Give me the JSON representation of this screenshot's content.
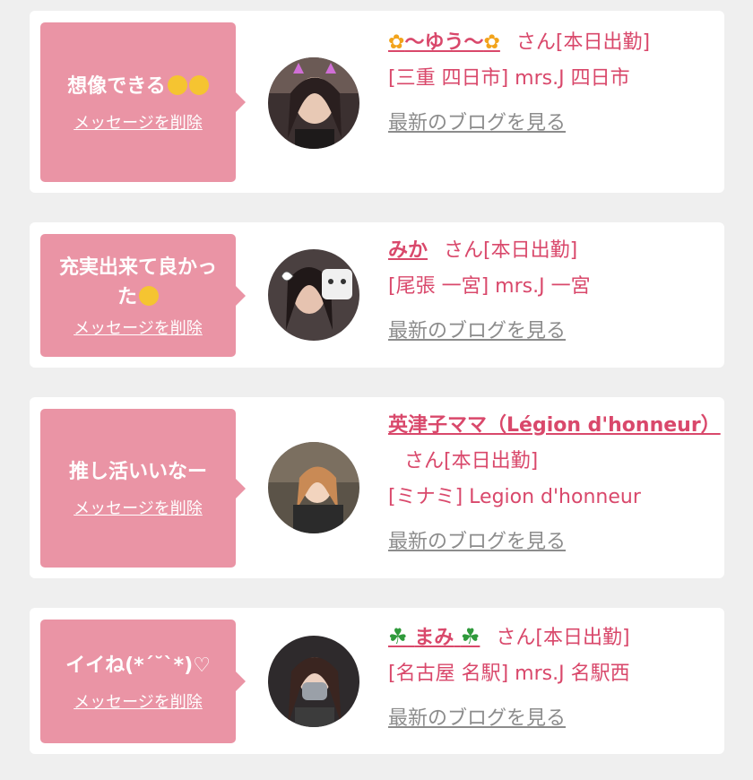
{
  "cards": [
    {
      "message": "想像できる",
      "emoji": [
        "rofl-emoji",
        "rofl-emoji"
      ],
      "delete_label": "メッセージを削除",
      "name_prefix": "✿",
      "name": "〜ゆう〜",
      "name_suffix": "✿",
      "san_status": "さん[本日出勤]",
      "shop": "[三重 四日市] mrs.J 四日市",
      "blog_label": "最新のブログを見る"
    },
    {
      "message": "充実出来て良かった",
      "emoji": [
        "hand-over-mouth-emoji"
      ],
      "delete_label": "メッセージを削除",
      "name": "みか",
      "san_status": "さん[本日出勤]",
      "shop": "[尾張 一宮] mrs.J 一宮",
      "blog_label": "最新のブログを見る"
    },
    {
      "message": "推し活いいなー",
      "delete_label": "メッセージを削除",
      "name": "英津子ママ（Légion d'honneur）",
      "san_status": "さん[本日出勤]",
      "shop": "[ミナミ] Legion d'honneur",
      "blog_label": "最新のブログを見る"
    },
    {
      "message": "イイね(*´˘`*)♡",
      "delete_label": "メッセージを削除",
      "name_prefix": "☘",
      "name": "まみ",
      "name_suffix": "☘",
      "san_status": "さん[本日出勤]",
      "shop": "[名古屋 名駅] mrs.J 名駅西",
      "blog_label": "最新のブログを見る"
    }
  ]
}
